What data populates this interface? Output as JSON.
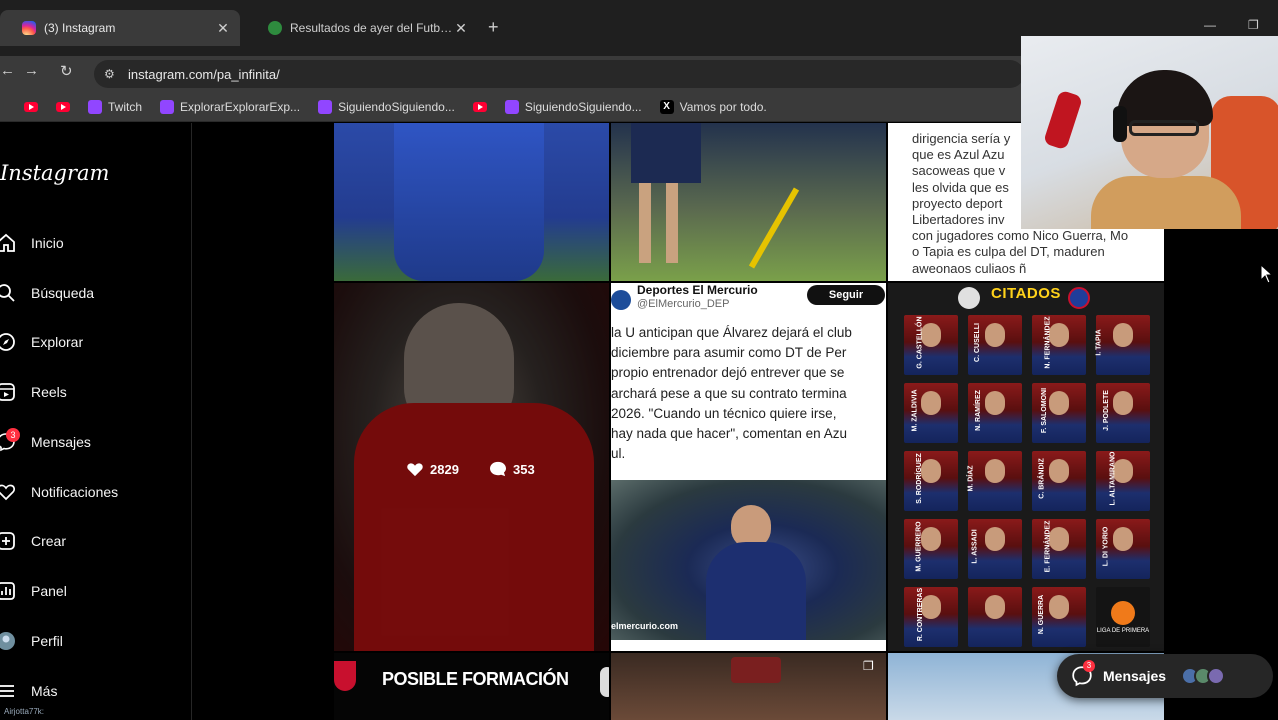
{
  "browser": {
    "tabs": [
      {
        "title": "(3) Instagram",
        "active": true,
        "favicon": "instagram-icon"
      },
      {
        "title": "Resultados de ayer del Futbol Argentino",
        "active": false,
        "favicon": "soccer-icon"
      }
    ],
    "new_tab": "+",
    "url": "instagram.com/pa_infinita/",
    "bookmarks": [
      {
        "label": "",
        "icon": "youtube-icon"
      },
      {
        "label": "",
        "icon": "youtube-icon"
      },
      {
        "label": "Twitch",
        "icon": "twitch-icon"
      },
      {
        "label": "ExplorarExplorarExp...",
        "icon": "twitch-icon"
      },
      {
        "label": "SiguiendoSiguiendo...",
        "icon": "twitch-icon"
      },
      {
        "label": "",
        "icon": "youtube-icon"
      },
      {
        "label": "SiguiendoSiguiendo...",
        "icon": "twitch-icon"
      },
      {
        "label": "Vamos por todo.",
        "icon": "x-icon"
      }
    ]
  },
  "sidebar": {
    "logo": "Instagram",
    "items": [
      {
        "label": "Inicio",
        "icon": "home-icon"
      },
      {
        "label": "Búsqueda",
        "icon": "search-icon"
      },
      {
        "label": "Explorar",
        "icon": "compass-icon"
      },
      {
        "label": "Reels",
        "icon": "reels-icon"
      },
      {
        "label": "Mensajes",
        "icon": "messenger-icon",
        "badge": "3"
      },
      {
        "label": "Notificaciones",
        "icon": "heart-icon"
      },
      {
        "label": "Crear",
        "icon": "plus-square-icon"
      },
      {
        "label": "Panel",
        "icon": "dashboard-icon"
      },
      {
        "label": "Perfil",
        "icon": "avatar-icon"
      },
      {
        "label": "Más",
        "icon": "menu-icon"
      }
    ],
    "status_text": "Airjotta77k:"
  },
  "grid": {
    "caption_snippet": "dirigencia sería y\nque es Azul Azu\nsacoweas que v\nles olvida que es\nproyecto deport\nLibertadores inv\ncon jugadores como Nico Guerra, Mo\no Tapia es culpa del DT, maduren\naweonaos culiaos ñ",
    "hover_post": {
      "likes": "2829",
      "comments": "353"
    },
    "tweet": {
      "name": "Deportes El Mercurio",
      "handle": "@ElMercurio_DEP",
      "follow_label": "Seguir",
      "text": "la U anticipan que Álvarez dejará el club\n diciembre para asumir como DT de Per\npropio entrenador dejó entrever que se\narchará pese a que su contrato termina\n2026. \"Cuando un técnico quiere irse,\n hay nada que hacer\", comentan en Azu\nul.",
      "photo_caption": "elmercurio.com"
    },
    "citados": {
      "title": "CITADOS",
      "players": [
        "G. CASTELLÓN",
        "C. CUSELLI",
        "N. FERNÁNDEZ",
        "I. TAPIA",
        "M. ZALDIVIA",
        "N. RAMÍREZ",
        "F. SALOMONI",
        "J. PODLETE",
        "S. RODRÍGUEZ",
        "M. DÍAZ",
        "C. BRÁNDIZ",
        "L. ALTAMIRANO",
        "M. GUERRERO",
        "L. ASSADI",
        "E. FERNÁNDEZ",
        "L. DI YORIO",
        "R. CONTRERAS",
        "",
        "N. GUERRA",
        ""
      ],
      "liga_label": "LIGA DE PRIMERA"
    },
    "posible_title": "POSIBLE FORMACIÓN"
  },
  "messages_pill": {
    "label": "Mensajes",
    "badge": "3"
  },
  "colors": {
    "accent_red": "#ff3040",
    "citados_yellow": "#ffd21a",
    "twitch": "#9146ff",
    "youtube": "#ff0033"
  }
}
